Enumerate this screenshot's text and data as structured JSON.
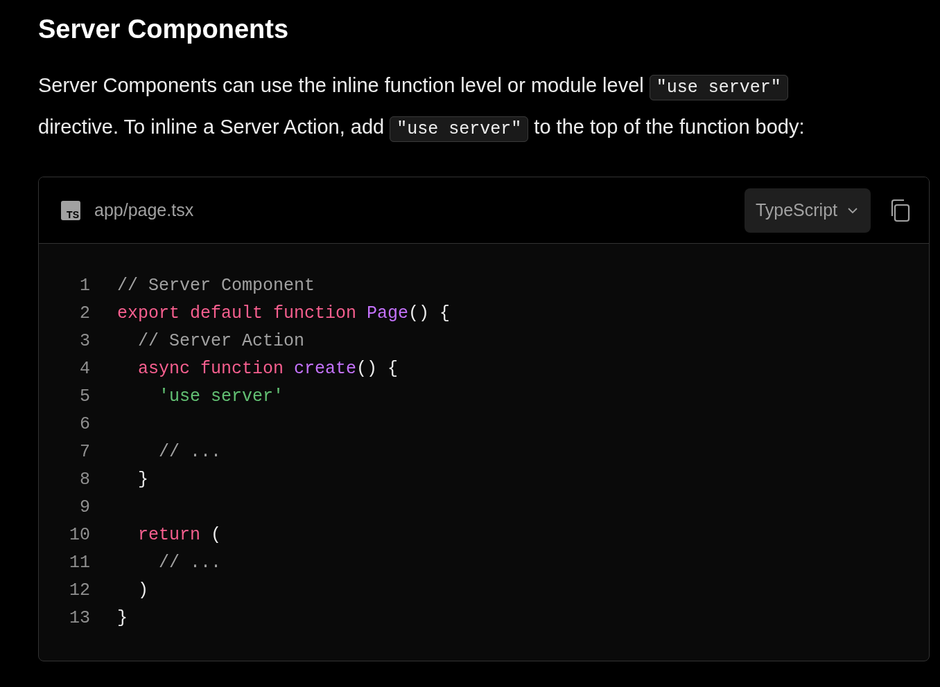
{
  "heading": "Server Components",
  "paragraph": [
    {
      "kind": "text",
      "text": "Server Components can use the inline function level or module level"
    },
    {
      "kind": "code",
      "text": "\"use server\""
    },
    {
      "kind": "text",
      "text": "directive. To inline a Server Action, add"
    },
    {
      "kind": "code",
      "text": "\"use server\""
    },
    {
      "kind": "text",
      "text": "to the top of the function body:"
    }
  ],
  "code_block": {
    "filename": "app/page.tsx",
    "file_badge": "TS",
    "language": "TypeScript",
    "lines": [
      {
        "number": "1",
        "tokens": [
          {
            "kind": "comment",
            "text": "// Server Component"
          }
        ]
      },
      {
        "number": "2",
        "tokens": [
          {
            "kind": "keyword",
            "text": "export default function "
          },
          {
            "kind": "function",
            "text": "Page"
          },
          {
            "kind": "plain",
            "text": "() {"
          }
        ]
      },
      {
        "number": "3",
        "tokens": [
          {
            "kind": "comment",
            "text": "  // Server Action"
          }
        ]
      },
      {
        "number": "4",
        "tokens": [
          {
            "kind": "keyword",
            "text": "  async function "
          },
          {
            "kind": "function",
            "text": "create"
          },
          {
            "kind": "plain",
            "text": "() {"
          }
        ]
      },
      {
        "number": "5",
        "tokens": [
          {
            "kind": "string",
            "text": "    'use server'"
          }
        ]
      },
      {
        "number": "6"
      },
      {
        "number": "7",
        "tokens": [
          {
            "kind": "comment",
            "text": "    // ..."
          }
        ]
      },
      {
        "number": "8",
        "tokens": [
          {
            "kind": "plain",
            "text": "  }"
          }
        ]
      },
      {
        "number": "9"
      },
      {
        "number": "10",
        "tokens": [
          {
            "kind": "keyword",
            "text": "  return "
          },
          {
            "kind": "plain",
            "text": "("
          }
        ]
      },
      {
        "number": "11",
        "tokens": [
          {
            "kind": "comment",
            "text": "    // ..."
          }
        ]
      },
      {
        "number": "12",
        "tokens": [
          {
            "kind": "plain",
            "text": "  )"
          }
        ]
      },
      {
        "number": "13",
        "tokens": [
          {
            "kind": "plain",
            "text": "}"
          }
        ]
      }
    ]
  }
}
